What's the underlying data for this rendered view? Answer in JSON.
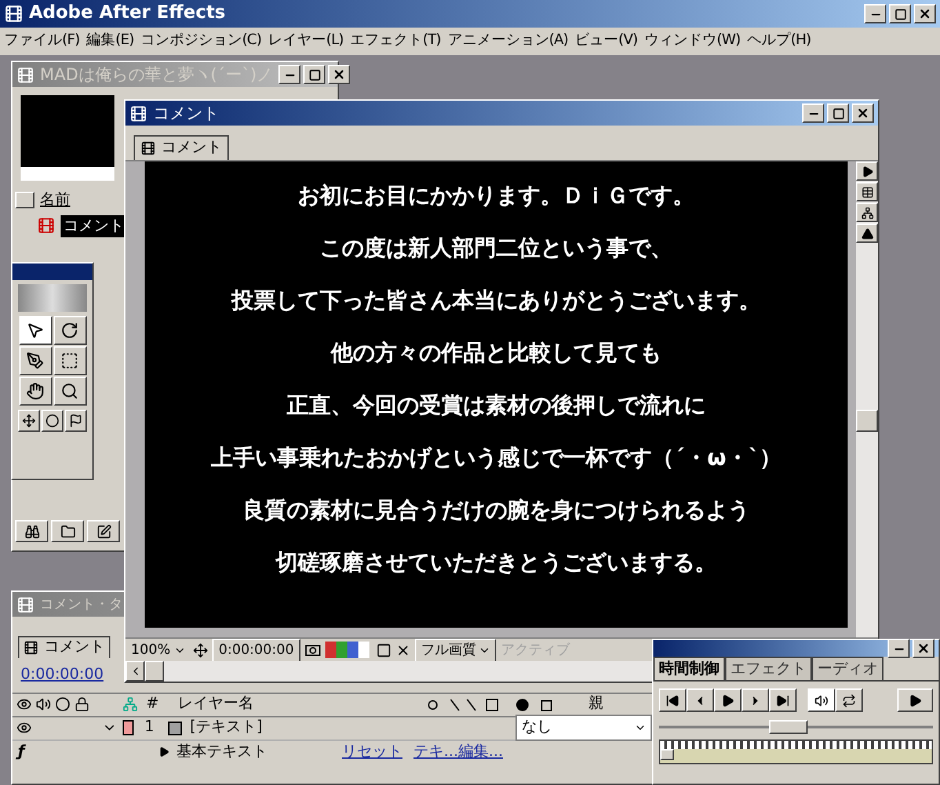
{
  "app": {
    "title": "Adobe After Effects"
  },
  "menu": [
    "ファイル(F)",
    "編集(E)",
    "コンポジション(C)",
    "レイヤー(L)",
    "エフェクト(T)",
    "アニメーション(A)",
    "ビュー(V)",
    "ウィンドウ(W)",
    "ヘルプ(H)"
  ],
  "project": {
    "title": "MADは俺らの華と夢ヽ(´ー`)ノ",
    "column": "名前",
    "items": [
      {
        "label": "コメント",
        "selected": true
      }
    ]
  },
  "comp": {
    "title": "コメント",
    "tab": "コメント",
    "lines": [
      "お初にお目にかかります。ＤｉＧです。",
      "この度は新人部門二位という事で、",
      "投票して下った皆さん本当にありがとうございます。",
      "他の方々の作品と比較して見ても",
      "正直、今回の受賞は素材の後押しで流れに",
      "上手い事乗れたおかげという感じで一杯です（´・ω・`）",
      "良質の素材に見合うだけの腕を身につけられるよう",
      "切磋琢磨させていただきとうございまする。"
    ],
    "zoom": "100%",
    "time": "0:00:00:00",
    "quality": "フル画質",
    "view": "アクティブ"
  },
  "timeline": {
    "title": "コメント・タ",
    "tab": "コメント",
    "time": "0:00:00:00",
    "columns": [
      "#",
      "レイヤー名",
      "親"
    ],
    "layers": [
      {
        "number": "1",
        "name": "[テキスト]",
        "parent": "なし",
        "expanded": true,
        "color": "#f09a9a"
      }
    ],
    "property": {
      "effect_mark": "ƒ",
      "name": "基本テキスト",
      "links": [
        "リセット",
        "テキ...編集..."
      ]
    }
  },
  "time_controls": {
    "jog": {
      "level": 0.47
    },
    "tabs": [
      {
        "label": "時間制御",
        "selected": true
      },
      {
        "label": "エフェクト",
        "selected": false
      },
      {
        "label": "ーディオ",
        "selected": false
      }
    ]
  }
}
